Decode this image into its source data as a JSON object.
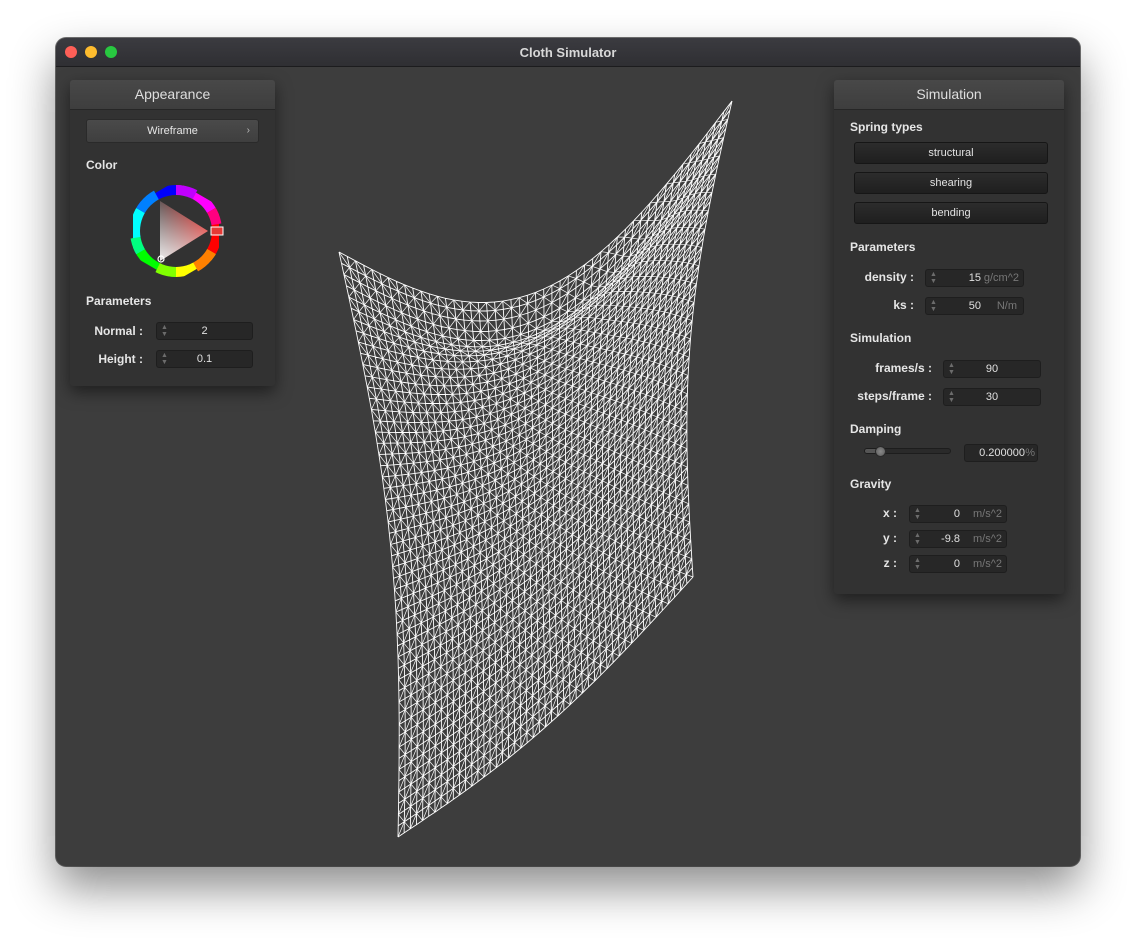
{
  "window": {
    "title": "Cloth Simulator"
  },
  "appearance": {
    "header": "Appearance",
    "shader_button": "Wireframe",
    "color_label": "Color",
    "parameters_label": "Parameters",
    "normal_label": "Normal :",
    "normal_value": "2",
    "height_label": "Height :",
    "height_value": "0.1"
  },
  "simulation": {
    "header": "Simulation",
    "spring_types_label": "Spring types",
    "spring_buttons": [
      "structural",
      "shearing",
      "bending"
    ],
    "parameters_label": "Parameters",
    "density_label": "density :",
    "density_value": "15",
    "density_unit": "g/cm^2",
    "ks_label": "ks :",
    "ks_value": "50",
    "ks_unit": "N/m",
    "sim_label": "Simulation",
    "fps_label": "frames/s :",
    "fps_value": "90",
    "steps_label": "steps/frame :",
    "steps_value": "30",
    "damping_label": "Damping",
    "damping_value": "0.200000",
    "damping_unit": "%",
    "damping_fraction": 0.2,
    "gravity_label": "Gravity",
    "gravity_x_label": "x :",
    "gravity_x_value": "0",
    "gravity_y_label": "y :",
    "gravity_y_value": "-9.8",
    "gravity_z_label": "z :",
    "gravity_z_value": "0",
    "gravity_unit": "m/s^2"
  },
  "colors": {
    "viewport_bg": "#3d3d3d",
    "mesh": "#ffffff",
    "panel_bg": "#323232",
    "color_marker": "#e53935"
  }
}
